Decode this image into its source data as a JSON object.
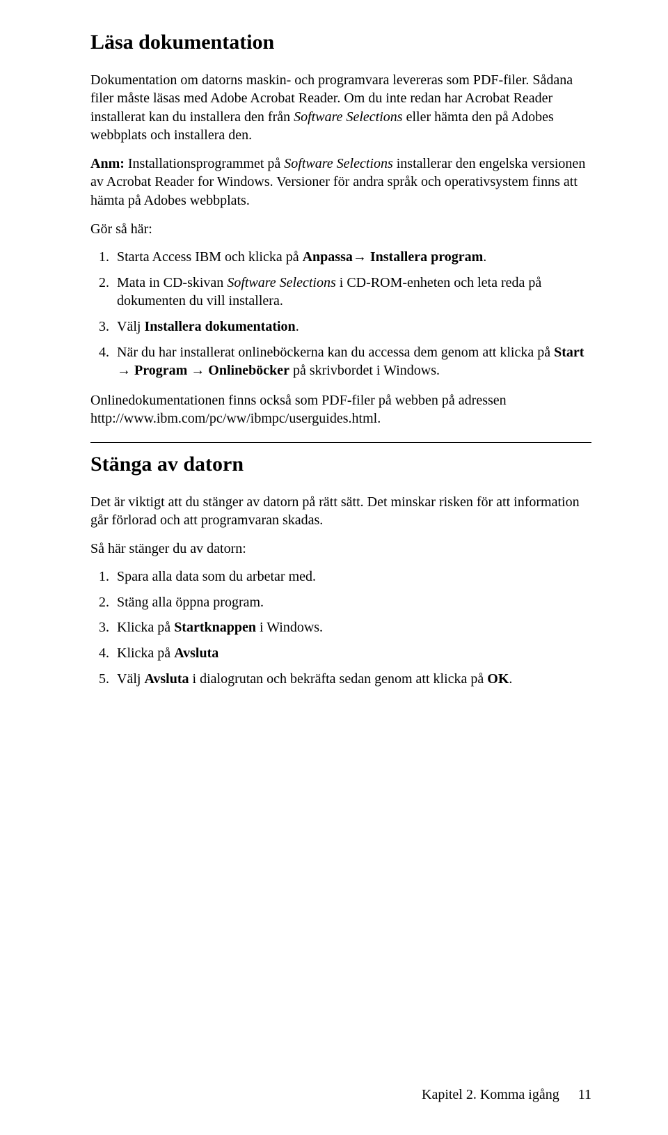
{
  "section1": {
    "title": "Läsa dokumentation",
    "p1_a": "Dokumentation om datorns maskin- och programvara levereras som PDF-filer. Sådana filer måste läsas med Adobe Acrobat Reader. Om du inte redan har Acrobat Reader installerat kan du installera den från ",
    "p1_i1": "Software Selections",
    "p1_b": " eller hämta den på Adobes webbplats och installera den.",
    "p2_b1": "Anm:",
    "p2_a": " Installationsprogrammet på ",
    "p2_i1": "Software Selections",
    "p2_b": " installerar den engelska versionen av Acrobat Reader for Windows. Versioner för andra språk och operativsystem finns att hämta på Adobes webbplats.",
    "p3": "Gör så här:",
    "li1_a": "Starta Access IBM och klicka på ",
    "li1_b": "Anpassa→ Installera program",
    "li1_c": ".",
    "li2_a": "Mata in CD-skivan ",
    "li2_i": "Software Selections",
    "li2_b": " i CD-ROM-enheten och leta reda på dokumenten du vill installera.",
    "li3_a": "Välj ",
    "li3_b": "Installera dokumentation",
    "li3_c": ".",
    "li4_a": "När du har installerat onlineböckerna kan du accessa dem genom att klicka på ",
    "li4_b": "Start → Program → Onlineböcker",
    "li4_c": " på skrivbordet i Windows.",
    "p4": "Onlinedokumentationen finns också som PDF-filer på webben på adressen http://www.ibm.com/pc/ww/ibmpc/userguides.html."
  },
  "section2": {
    "title": "Stänga av datorn",
    "p1": "Det är viktigt att du stänger av datorn på rätt sätt. Det minskar risken för att information går förlorad och att programvaran skadas.",
    "p2": "Så här stänger du av datorn:",
    "li1": "Spara alla data som du arbetar med.",
    "li2": "Stäng alla öppna program.",
    "li3_a": "Klicka på ",
    "li3_b": "Startknappen",
    "li3_c": " i Windows.",
    "li4_a": "Klicka på ",
    "li4_b": "Avsluta",
    "li5_a": "Välj ",
    "li5_b": "Avsluta",
    "li5_c": " i dialogrutan och bekräfta sedan genom att klicka på ",
    "li5_d": "OK",
    "li5_e": "."
  },
  "footer": {
    "chapter": "Kapitel 2. Komma igång",
    "page": "11"
  }
}
